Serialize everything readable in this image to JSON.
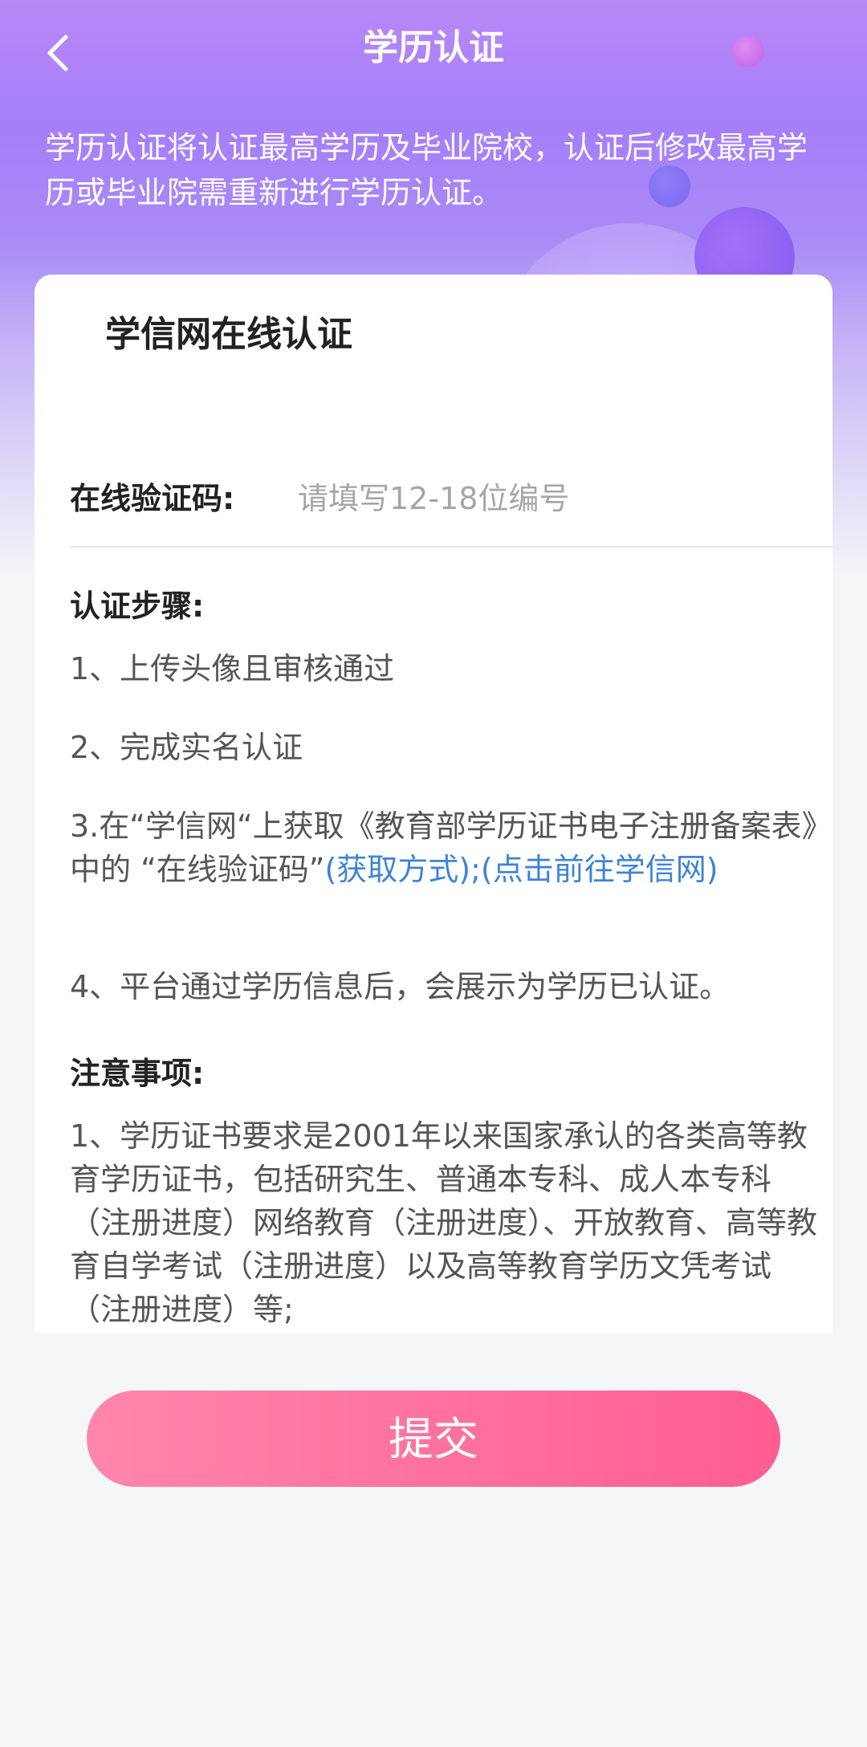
{
  "header": {
    "title": "学历认证",
    "back_icon": "chevron-left-icon",
    "notice": "学历认证将认证最高学历及毕业院校，认证后修改最高学历或毕业院需重新进行学历认证。"
  },
  "tabs": [
    {
      "label": "学信网在线认证",
      "active": true
    },
    {
      "label": "",
      "active": false
    }
  ],
  "form": {
    "label": "在线验证码:",
    "placeholder": "请填写12-18位编号",
    "value": ""
  },
  "steps": {
    "title": "认证步骤:",
    "item1": "1、上传头像且审核通过",
    "item2": "2、完成实名认证",
    "item3_text": "3.在“学信网“上获取《教育部学历证书电子注册备案表》中的 “在线验证码”",
    "item3_link1": "(获取方式)",
    "item3_sep": ";",
    "item3_link2": "(点击前往学信网)",
    "item4": "4、平台通过学历信息后，会展示为学历已认证。"
  },
  "notes": {
    "title": "注意事项:",
    "item1": "1、学历证书要求是2001年以来国家承认的各类高等教育学历证书，包括研究生、普通本专科、成人本专科 （注册进度）网络教育（注册进度）、开放教育、高等教育自学考试（注册进度）以及高等教育学历文凭考试 （注册进度）等;"
  },
  "submit_label": "提交",
  "colors": {
    "accent": "#a57ef8",
    "link": "#3d83d8",
    "button_start": "#ff86ab",
    "button_end": "#ff5d92"
  }
}
